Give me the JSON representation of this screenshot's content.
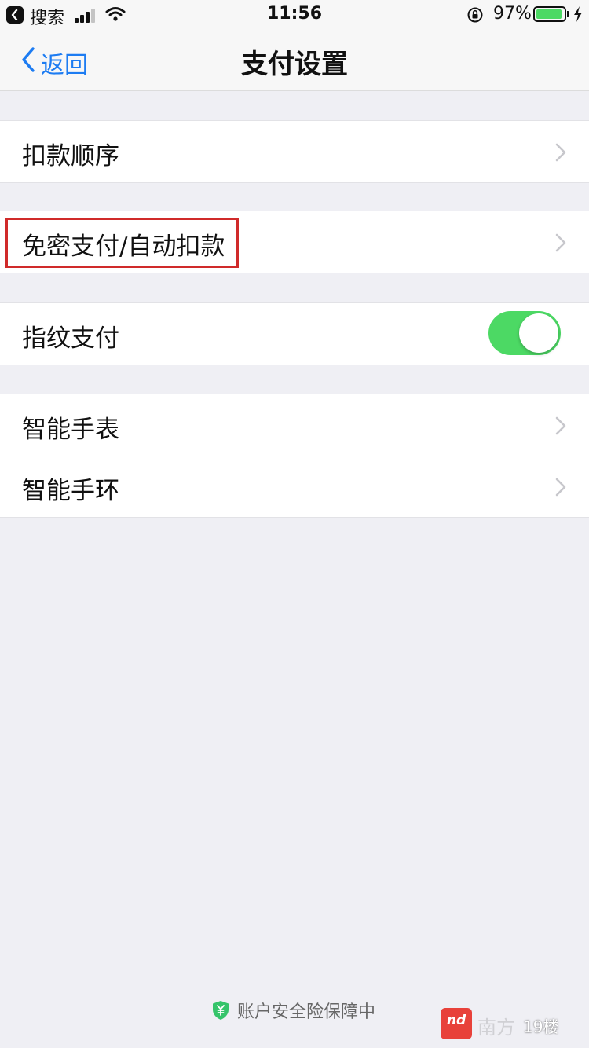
{
  "status_bar": {
    "back_app": "搜索",
    "time": "11:56",
    "battery": "97%",
    "battery_level": 0.97
  },
  "nav": {
    "back_label": "返回",
    "title": "支付设置"
  },
  "rows": {
    "deduction_order": "扣款顺序",
    "password_free": "免密支付/自动扣款",
    "fingerprint_pay": "指纹支付",
    "fingerprint_enabled": true,
    "smart_watch": "智能手表",
    "smart_band": "智能手环"
  },
  "footer": {
    "text": "账户安全险保障中"
  },
  "watermark": {
    "logo_text": "nd",
    "brand": "南方",
    "tag": "19楼"
  },
  "colors": {
    "accent": "#1d7cf2",
    "toggle_on": "#4cd964",
    "highlight_border": "#d02a2a",
    "background": "#efeff4"
  }
}
